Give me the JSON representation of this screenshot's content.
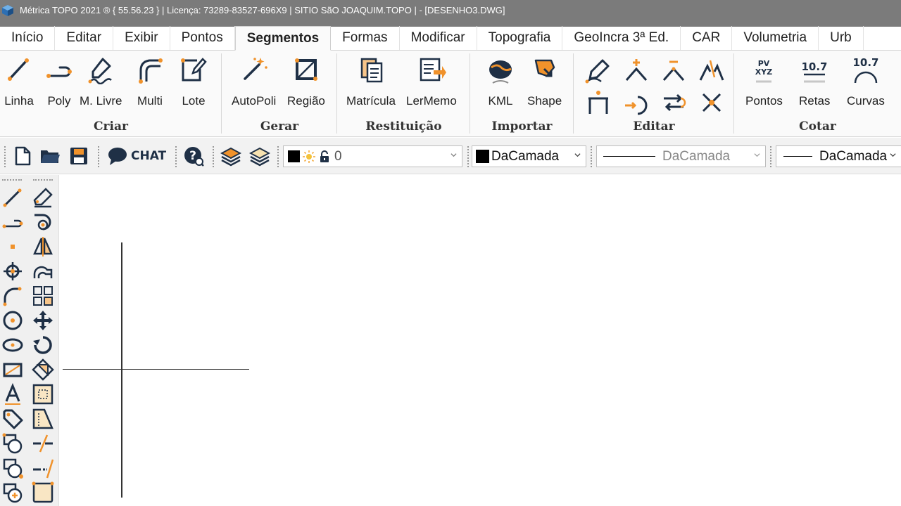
{
  "window": {
    "title": "Métrica TOPO 2021 ® { 55.56.23 } | Licença: 73289-83527-696X9 | SITIO SãO JOAQUIM.TOPO |  - [DESENHO3.DWG]"
  },
  "tabs": [
    {
      "label": "Início"
    },
    {
      "label": "Editar"
    },
    {
      "label": "Exibir"
    },
    {
      "label": "Pontos"
    },
    {
      "label": "Segmentos",
      "active": true
    },
    {
      "label": "Formas"
    },
    {
      "label": "Modificar"
    },
    {
      "label": "Topografia"
    },
    {
      "label": "GeoIncra 3ª Ed."
    },
    {
      "label": "CAR"
    },
    {
      "label": "Volumetria"
    },
    {
      "label": "Urb"
    }
  ],
  "ribbon": {
    "criar": {
      "label": "Criar",
      "buttons": [
        {
          "label": "Linha",
          "icon": "line-draw-icon"
        },
        {
          "label": "Poly",
          "icon": "polyline-icon"
        },
        {
          "label": "M. Livre",
          "icon": "freehand-icon"
        },
        {
          "label": "Multi",
          "icon": "multiline-icon"
        },
        {
          "label": "Lote",
          "icon": "lot-icon"
        }
      ]
    },
    "gerar": {
      "label": "Gerar",
      "buttons": [
        {
          "label": "AutoPoli",
          "icon": "magic-wand-icon"
        },
        {
          "label": "Região",
          "icon": "region-icon"
        }
      ]
    },
    "restituicao": {
      "label": "Restituição",
      "buttons": [
        {
          "label": "Matrícula",
          "icon": "documents-icon"
        },
        {
          "label": "LerMemo",
          "icon": "read-memo-icon"
        }
      ]
    },
    "importar": {
      "label": "Importar",
      "buttons": [
        {
          "label": "KML",
          "icon": "globe-icon"
        },
        {
          "label": "Shape",
          "icon": "shape-import-icon"
        }
      ]
    },
    "editar": {
      "label": "Editar",
      "icons": [
        "edit-pencil-icon",
        "add-vertex-icon",
        "remove-vertex-icon",
        "break-icon",
        "extend-icon",
        "join-icon",
        "reverse-icon",
        "intersect-icon"
      ]
    },
    "cotar": {
      "label": "Cotar",
      "buttons": [
        {
          "label": "Pontos",
          "icon": "pv-xyz-icon",
          "badge_top": "PV",
          "badge_mid": "XYZ"
        },
        {
          "label": "Retas",
          "icon": "dimension-line-icon",
          "badge": "10.7"
        },
        {
          "label": "Curvas",
          "icon": "dimension-arc-icon",
          "badge": "10.7"
        }
      ]
    }
  },
  "toolbar": {
    "chat_label": "CHAT",
    "layer_combo": {
      "value": "0"
    },
    "color_combo": {
      "value": "DaCamada"
    },
    "linetype_combo": {
      "value": "DaCamada"
    },
    "lineweight_combo": {
      "value": "DaCamada"
    }
  },
  "colors": {
    "accent_orange": "#f0922b",
    "icon_navy": "#1f3046",
    "titlebar": "#7b7b7b"
  }
}
